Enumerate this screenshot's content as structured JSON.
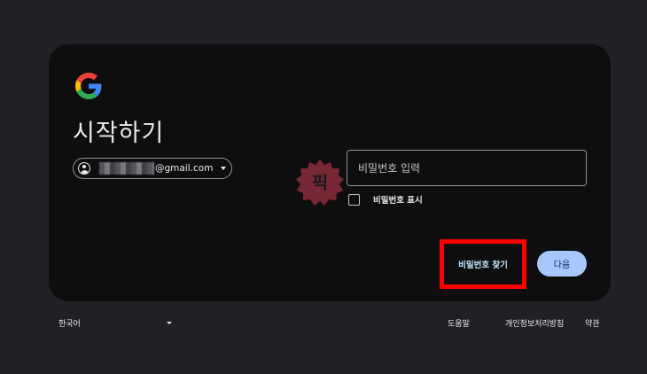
{
  "card": {
    "title": "시작하기",
    "account_email_suffix": "@gmail.com",
    "password_placeholder": "비밀번호 입력",
    "show_password_label": "비밀번호 표시",
    "forgot_password_label": "비밀번호 찾기",
    "next_label": "다음",
    "watermark_text": "픽"
  },
  "footer": {
    "language": "한국어",
    "links": [
      "도움말",
      "개인정보처리방침",
      "약관"
    ]
  },
  "colors": {
    "background": "#202124",
    "card": "#0e0e0f",
    "primary_button": "#a8c7fa",
    "highlight_box": "#ff0000",
    "watermark": "#8b2c3d"
  },
  "icons": {
    "logo": "google-g-logo",
    "avatar": "account-circle-icon",
    "dropdown": "chevron-down-icon",
    "checkbox": "checkbox-icon"
  }
}
